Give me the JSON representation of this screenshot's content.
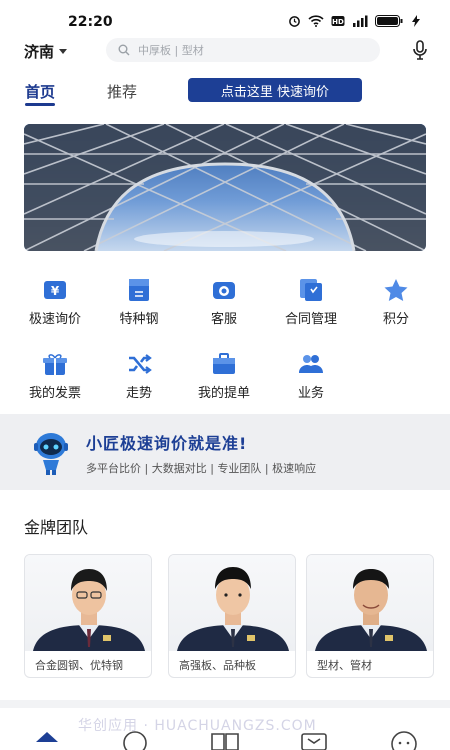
{
  "status_bar": {
    "time": "22:20"
  },
  "header": {
    "city": "济南",
    "search_placeholder": "中厚板 | 型材"
  },
  "tabs": [
    {
      "label": "首页",
      "active": true
    },
    {
      "label": "推荐",
      "active": false
    }
  ],
  "quick_inquiry_button": "点击这里 快速询价",
  "menu": [
    {
      "label": "极速询价",
      "icon": "yen-icon"
    },
    {
      "label": "特种钢",
      "icon": "document-icon"
    },
    {
      "label": "客服",
      "icon": "phone-icon"
    },
    {
      "label": "合同管理",
      "icon": "contract-icon"
    },
    {
      "label": "积分",
      "icon": "star-icon"
    },
    {
      "label": "我的发票",
      "icon": "gift-icon"
    },
    {
      "label": "走势",
      "icon": "shuffle-icon"
    },
    {
      "label": "我的提单",
      "icon": "briefcase-icon"
    },
    {
      "label": "业务",
      "icon": "people-icon"
    }
  ],
  "promo": {
    "title": "小匠极速询价就是准!",
    "subtitle": "多平台比价 | 大数据对比 | 专业团队 | 极速响应"
  },
  "team": {
    "heading": "金牌团队",
    "cards": [
      {
        "caption": "合金圆钢、优特钢"
      },
      {
        "caption": "高强板、品种板"
      },
      {
        "caption": "型材、管材"
      }
    ]
  },
  "watermark": "华创应用 · HUACHUANGZS.COM",
  "colors": {
    "brand": "#1d3f95",
    "icon_blue": "#2f6fd6"
  }
}
